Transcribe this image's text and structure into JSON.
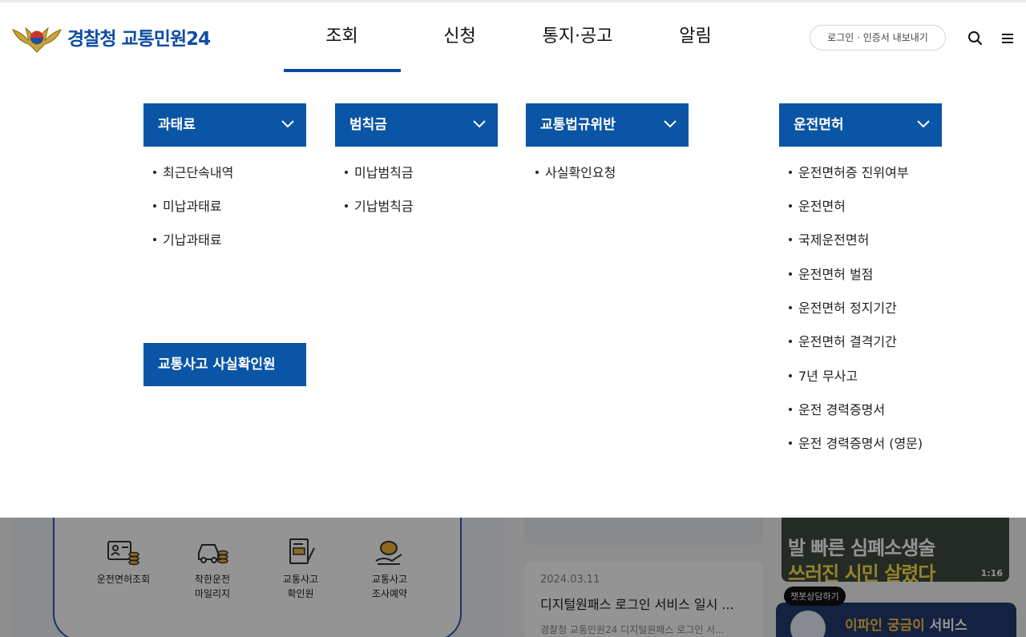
{
  "header": {
    "logo_text": "경찰청 교통민원24",
    "nav": [
      "조회",
      "신청",
      "통지·공고",
      "알림"
    ],
    "login_label": "로그인 · 인증서 내보내기"
  },
  "menu": {
    "columns": [
      {
        "title": "과태료",
        "items": [
          "최근단속내역",
          "미납과태료",
          "기납과태료"
        ]
      },
      {
        "title": "범칙금",
        "items": [
          "미납범칙금",
          "기납범칙금"
        ]
      },
      {
        "title": "교통법규위반",
        "items": [
          "사실확인요청"
        ]
      },
      {
        "title": "운전면허",
        "items": [
          "운전면허증 진위여부",
          "운전면허",
          "국제운전면허",
          "운전면허 벌점",
          "운전면허 정지기간",
          "운전면허 결격기간",
          "7년 무사고",
          "운전 경력증명서",
          "운전 경력증명서 (영문)"
        ]
      }
    ],
    "accident_button": "교통사고 사실확인원"
  },
  "background": {
    "quick_menu": [
      {
        "line1": "운전면허조회",
        "line2": ""
      },
      {
        "line1": "착한운전",
        "line2": "마일리지"
      },
      {
        "line1": "교통사고",
        "line2": "확인원"
      },
      {
        "line1": "교통사고",
        "line2": "조사예약"
      }
    ],
    "notice": {
      "date": "2024.03.11",
      "title": "디지털원패스 로그인 서비스 일시 ...",
      "desc": "경찰청 교통민원24  디지털원패스 로그인 서..."
    },
    "video": {
      "caption1": "발 빠른 심폐소생술",
      "caption2": "쓰러진 시민 살렸다",
      "duration": "1:16"
    },
    "chatbot": {
      "tooltip": "챗봇상담하기",
      "name": "이파인 궁금이",
      "suffix": " 서비스"
    }
  },
  "colors": {
    "brand": "#0a55a6",
    "nav_active": "#0a4b9e",
    "logo": "#0e4da2"
  }
}
